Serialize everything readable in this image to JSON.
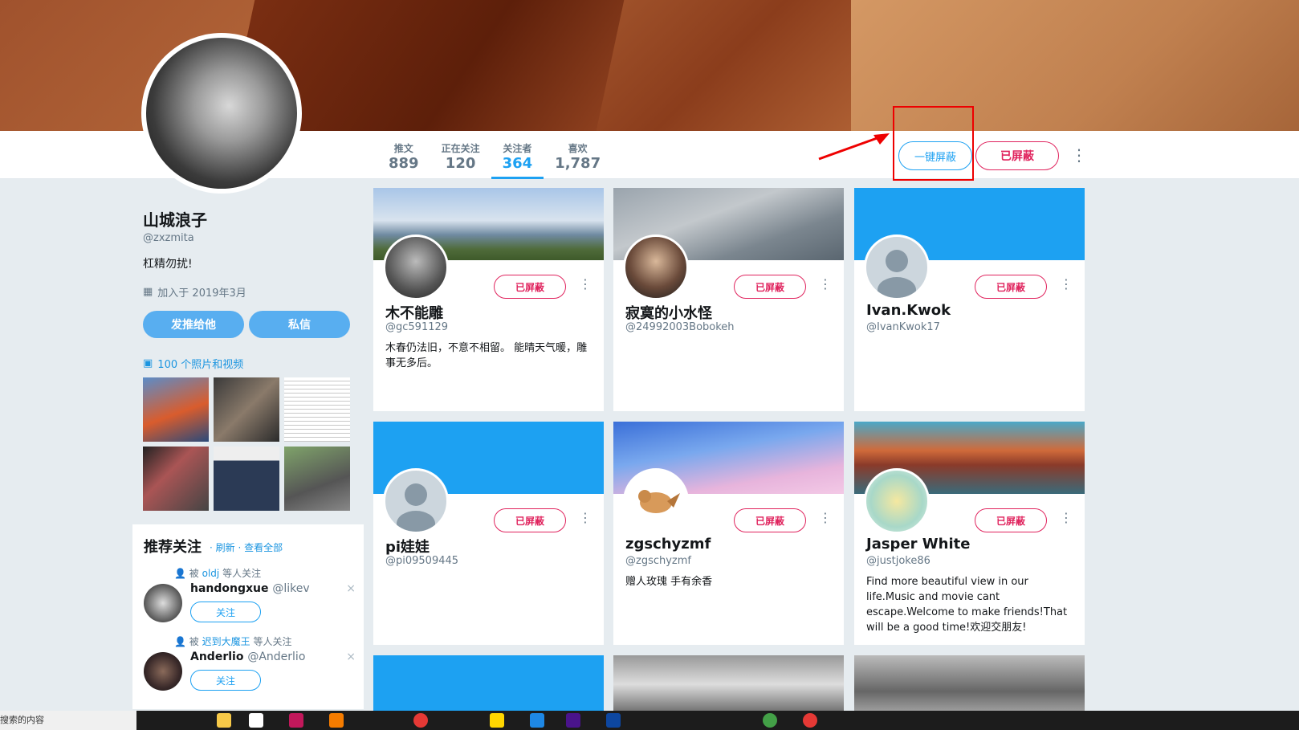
{
  "profile": {
    "name": "山城浪子",
    "handle": "@zxzmita",
    "bio": "杠精勿扰!",
    "joined": "加入于 2019年3月",
    "tweet_button": "发推给他",
    "dm_button": "私信",
    "photos_link": "100 个照片和视频"
  },
  "stats": [
    {
      "label": "推文",
      "value": "889"
    },
    {
      "label": "正在关注",
      "value": "120"
    },
    {
      "label": "关注者",
      "value": "364"
    },
    {
      "label": "喜欢",
      "value": "1,787"
    }
  ],
  "actions": {
    "one_click_block": "一键屏蔽",
    "blocked": "已屏蔽"
  },
  "recommend": {
    "title": "推荐关注",
    "refresh": "刷新",
    "view_all": "查看全部",
    "follow_label": "关注",
    "items": [
      {
        "by_prefix": "被",
        "by_user": "oldj",
        "by_suffix": "等人关注",
        "name": "handongxue",
        "handle": "@likev"
      },
      {
        "by_prefix": "被",
        "by_user": "迟到大魔王",
        "by_suffix": "等人关注",
        "name": "Anderlio",
        "handle": "@Anderlio"
      }
    ]
  },
  "cards": [
    {
      "name": "木不能雕",
      "handle": "@gc591129",
      "bio": "木春仍法旧，不意不相留。 能晴天气暖，雕事无多后。",
      "blocked": "已屏蔽"
    },
    {
      "name": "寂寞的小水怪",
      "handle": "@24992003Bobokeh",
      "bio": "",
      "blocked": "已屏蔽"
    },
    {
      "name": "Ivan.Kwok",
      "handle": "@IvanKwok17",
      "bio": "",
      "blocked": "已屏蔽"
    },
    {
      "name": "pi娃娃",
      "handle": "@pi09509445",
      "bio": "",
      "blocked": "已屏蔽"
    },
    {
      "name": "zgschyzmf",
      "handle": "@zgschyzmf",
      "bio": "赠人玫瑰 手有余香",
      "blocked": "已屏蔽"
    },
    {
      "name": "Jasper White",
      "handle": "@justjoke86",
      "bio": "Find more beautiful view in our life.Music and movie cant escape.Welcome to make friends!That will be a good time!欢迎交朋友!",
      "blocked": "已屏蔽"
    }
  ],
  "taskbar": {
    "search_placeholder": "搜索的内容"
  },
  "colors": {
    "accent": "#1da1f2",
    "blocked": "#e0245e",
    "highlight": "#ee0000"
  }
}
